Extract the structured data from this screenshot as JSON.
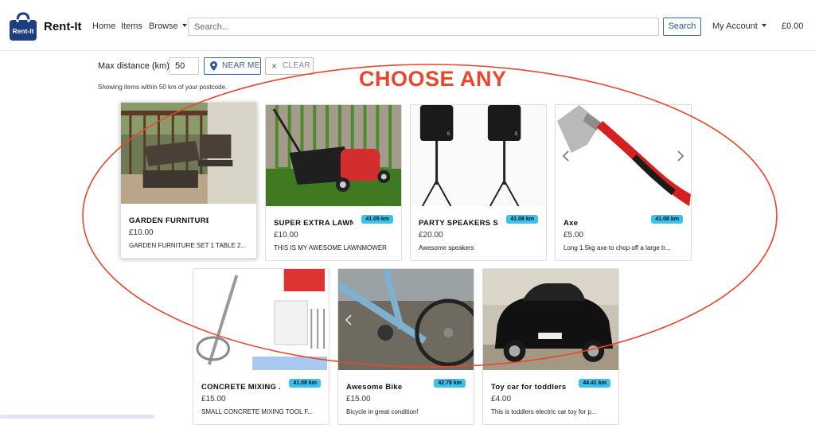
{
  "header": {
    "brand": "Rent-It",
    "logo_text": "Rent-It",
    "nav": {
      "home": "Home",
      "items": "Items",
      "browse": "Browse"
    },
    "search_placeholder": "Search...",
    "search_button": "Search",
    "account": "My Account",
    "cart_total": "£0.00"
  },
  "filters": {
    "max_distance_label": "Max distance (km)",
    "max_distance_value": "50",
    "near_me": "NEAR ME",
    "clear": "CLEAR",
    "showing_text": "Showing items within 50 km of your postcode."
  },
  "annotation": {
    "text": "CHOOSE ANY",
    "color": "#e8472c"
  },
  "accent_colors": {
    "primary": "#2f5aa0",
    "badge": "#3cc1ec"
  },
  "items": [
    {
      "title": "GARDEN FURNITURE SET",
      "price": "£10.00",
      "description": "GARDEN FURNITURE SET 1 TABLE 2...",
      "distance": ""
    },
    {
      "title": "SUPER EXTRA LAWN...",
      "price": "£10.00",
      "description": "THIS IS MY AWESOME LAWNMOWER",
      "distance": "41.05 km"
    },
    {
      "title": "PARTY SPEAKERS S...",
      "price": "£20.00",
      "description": "Awesome speakers",
      "distance": "41.08 km"
    },
    {
      "title": "Axe",
      "price": "£5.00",
      "description": "Long 1.5kg axe to chop off a large tr...",
      "distance": "41.08 km"
    },
    {
      "title": "CONCRETE MIXING ...",
      "price": "£15.00",
      "description": "SMALL CONCRETE MIXING TOOL F...",
      "distance": "41.08 km"
    },
    {
      "title": "Awesome Bike",
      "price": "£15.00",
      "description": "Bicycle in great condition!",
      "distance": "42.78 km"
    },
    {
      "title": "Toy car for toddlers",
      "price": "£4.00",
      "description": "This is toddlers electric car toy for p...",
      "distance": "44.41 km"
    }
  ]
}
